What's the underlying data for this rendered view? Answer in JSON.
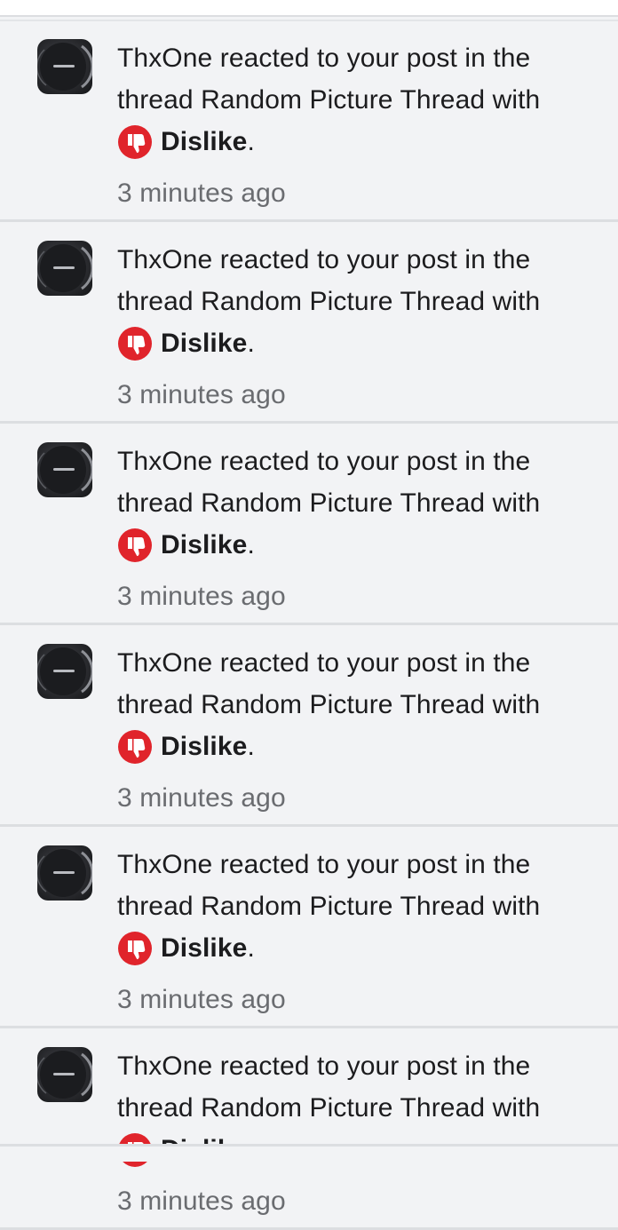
{
  "notifications": [
    {
      "user": "ThxOne",
      "line1": "ThxOne reacted to your post in the",
      "line2": "thread Random Picture Thread with",
      "reaction": "Dislike",
      "reaction_suffix": ".",
      "time": "3 minutes ago"
    },
    {
      "user": "ThxOne",
      "line1": "ThxOne reacted to your post in the",
      "line2": "thread Random Picture Thread with",
      "reaction": "Dislike",
      "reaction_suffix": ".",
      "time": "3 minutes ago"
    },
    {
      "user": "ThxOne",
      "line1": "ThxOne reacted to your post in the",
      "line2": "thread Random Picture Thread with",
      "reaction": "Dislike",
      "reaction_suffix": ".",
      "time": "3 minutes ago"
    },
    {
      "user": "ThxOne",
      "line1": "ThxOne reacted to your post in the",
      "line2": "thread Random Picture Thread with",
      "reaction": "Dislike",
      "reaction_suffix": ".",
      "time": "3 minutes ago"
    },
    {
      "user": "ThxOne",
      "line1": "ThxOne reacted to your post in the",
      "line2": "thread Random Picture Thread with",
      "reaction": "Dislike",
      "reaction_suffix": ".",
      "time": "3 minutes ago"
    },
    {
      "user": "ThxOne",
      "line1": "ThxOne reacted to your post in the",
      "line2": "thread Random Picture Thread with",
      "reaction": "Dislike",
      "reaction_suffix": ".",
      "time": "3 minutes ago"
    }
  ],
  "icons": {
    "avatar": "avatar-icon",
    "reaction": "thumbs-down-icon"
  },
  "colors": {
    "background": "#f2f3f5",
    "divider": "#dcdee1",
    "text": "#1c1c1e",
    "muted": "#6a6c70",
    "dislike_red": "#e0242b"
  }
}
